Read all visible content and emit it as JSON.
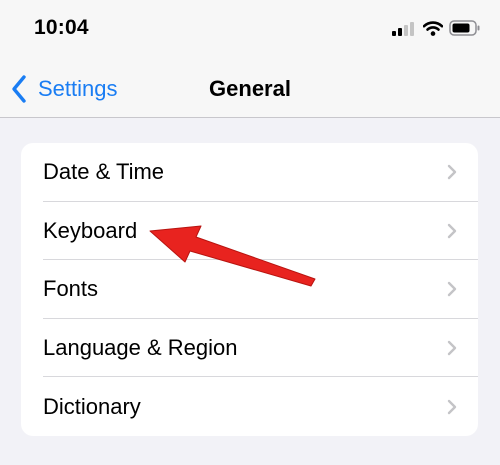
{
  "status_bar": {
    "time": "10:04",
    "icons": [
      "cellular-signal-icon",
      "wifi-icon",
      "battery-icon"
    ]
  },
  "nav_bar": {
    "back_label": "Settings",
    "title": "General"
  },
  "list": {
    "items": [
      {
        "label": "Date & Time"
      },
      {
        "label": "Keyboard"
      },
      {
        "label": "Fonts"
      },
      {
        "label": "Language & Region"
      },
      {
        "label": "Dictionary"
      }
    ]
  },
  "colors": {
    "accent": "#1a7df3",
    "annotation_arrow": "#e8231f",
    "background": "#f2f2f7"
  }
}
